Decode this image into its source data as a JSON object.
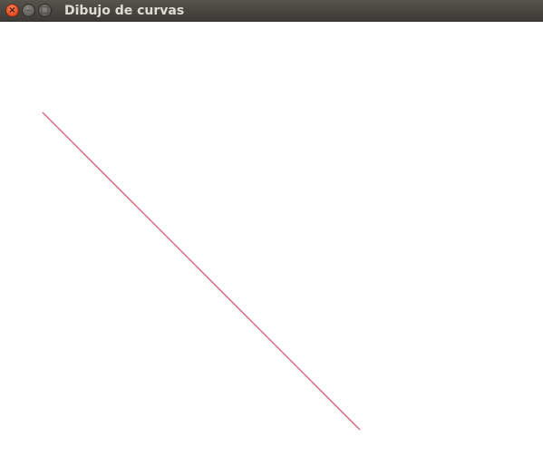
{
  "window": {
    "title": "Dibujo de curvas",
    "controls": {
      "close_icon": "close-icon",
      "minimize_icon": "minimize-icon",
      "maximize_icon": "maximize-icon"
    }
  },
  "drawing": {
    "line_color": "#d2364f",
    "background_color": "#ffffff"
  }
}
